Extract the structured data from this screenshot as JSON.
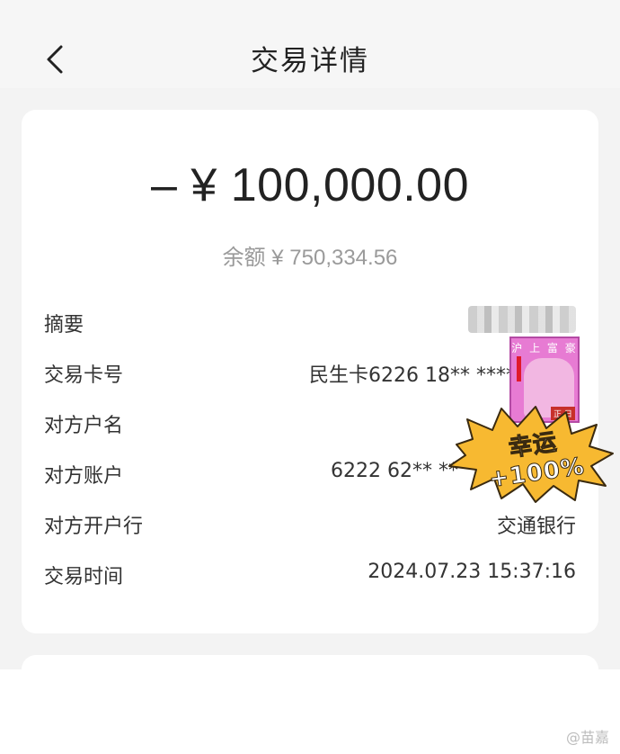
{
  "header": {
    "title": "交易详情",
    "back_icon": "chevron-left-icon"
  },
  "transaction": {
    "amount": "– ¥ 100,000.00",
    "balance": "余额 ¥ 750,334.56"
  },
  "rows": [
    {
      "label": "摘要",
      "value": ""
    },
    {
      "label": "交易卡号",
      "value": "民生卡6226 18** ****"
    },
    {
      "label": "对方户名",
      "value": ""
    },
    {
      "label": "对方账户",
      "value": "6222 62** **"
    },
    {
      "label": "对方开户行",
      "value": "交通银行"
    },
    {
      "label": "交易时间",
      "value": "2024.07.23 15:37:16"
    }
  ],
  "sticker": {
    "photo_title": "沪 上 富 豪",
    "photo_tag": "正 日",
    "burst_text": "幸运+100%",
    "colors": {
      "photo_bg": "#e77bd3",
      "burst_fill": "#f7b931"
    }
  },
  "watermark": "@苗嘉"
}
